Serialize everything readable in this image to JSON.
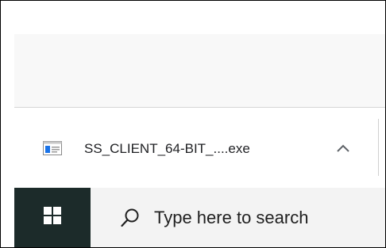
{
  "download_bar": {
    "file_name": "SS_CLIENT_64-BIT_....exe",
    "file_icon": "window-app-icon",
    "chevron_icon": "chevron-up-icon"
  },
  "taskbar": {
    "start_icon": "windows-logo-icon",
    "search_icon": "search-icon",
    "search_placeholder": "Type here to search"
  },
  "colors": {
    "taskbar_bg": "#1c2b2a",
    "search_bg": "#f3f3f3",
    "icon_accent": "#1a73e8"
  }
}
